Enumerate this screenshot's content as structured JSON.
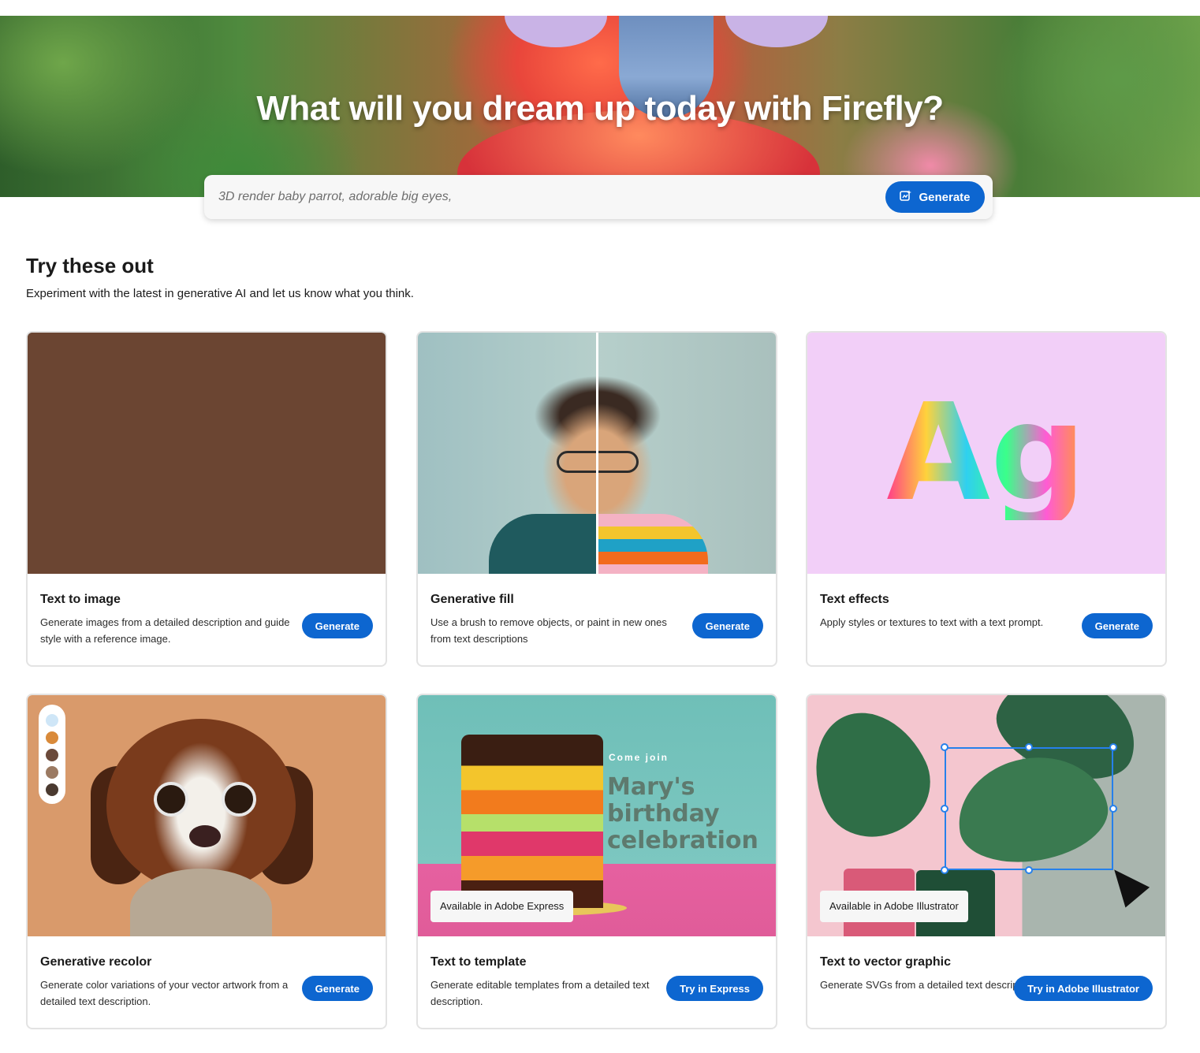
{
  "hero": {
    "title": "What will you dream up today with Firefly?",
    "search_placeholder": "3D render baby parrot, adorable big eyes,",
    "generate_label": "Generate"
  },
  "section": {
    "title": "Try these out",
    "subtitle": "Experiment with the latest in generative AI and let us know what you think."
  },
  "cards": [
    {
      "title": "Text to image",
      "description": "Generate images from a detailed description and guide style with a reference image.",
      "button": "Generate"
    },
    {
      "title": "Generative fill",
      "description": "Use a brush to remove objects, or paint in new ones from text descriptions",
      "button": "Generate"
    },
    {
      "title": "Text effects",
      "description": "Apply styles or textures to text with a text prompt.",
      "button": "Generate",
      "image_text": "Ag"
    },
    {
      "title": "Generative recolor",
      "description": "Generate color variations of your vector artwork from a detailed text description.",
      "button": "Generate",
      "palette_colors": [
        "#cfe6f7",
        "#d98a3a",
        "#6b4a3a",
        "#9b7a62",
        "#4a3a30"
      ]
    },
    {
      "title": "Text to template",
      "description": "Generate editable templates from a detailed text description.",
      "button": "Try in Express",
      "badge": "Available in Adobe Express",
      "image_text": {
        "line1": "Come join",
        "line2": "Mary's",
        "line3": "birthday",
        "line4": "celebration"
      }
    },
    {
      "title": "Text to vector graphic",
      "description": "Generate SVGs from a detailed text description.",
      "button": "Try in Adobe Illustrator",
      "badge": "Available in Adobe Illustrator"
    }
  ],
  "colors": {
    "accent": "#0d66d0",
    "card_border": "#e3e3e3"
  }
}
